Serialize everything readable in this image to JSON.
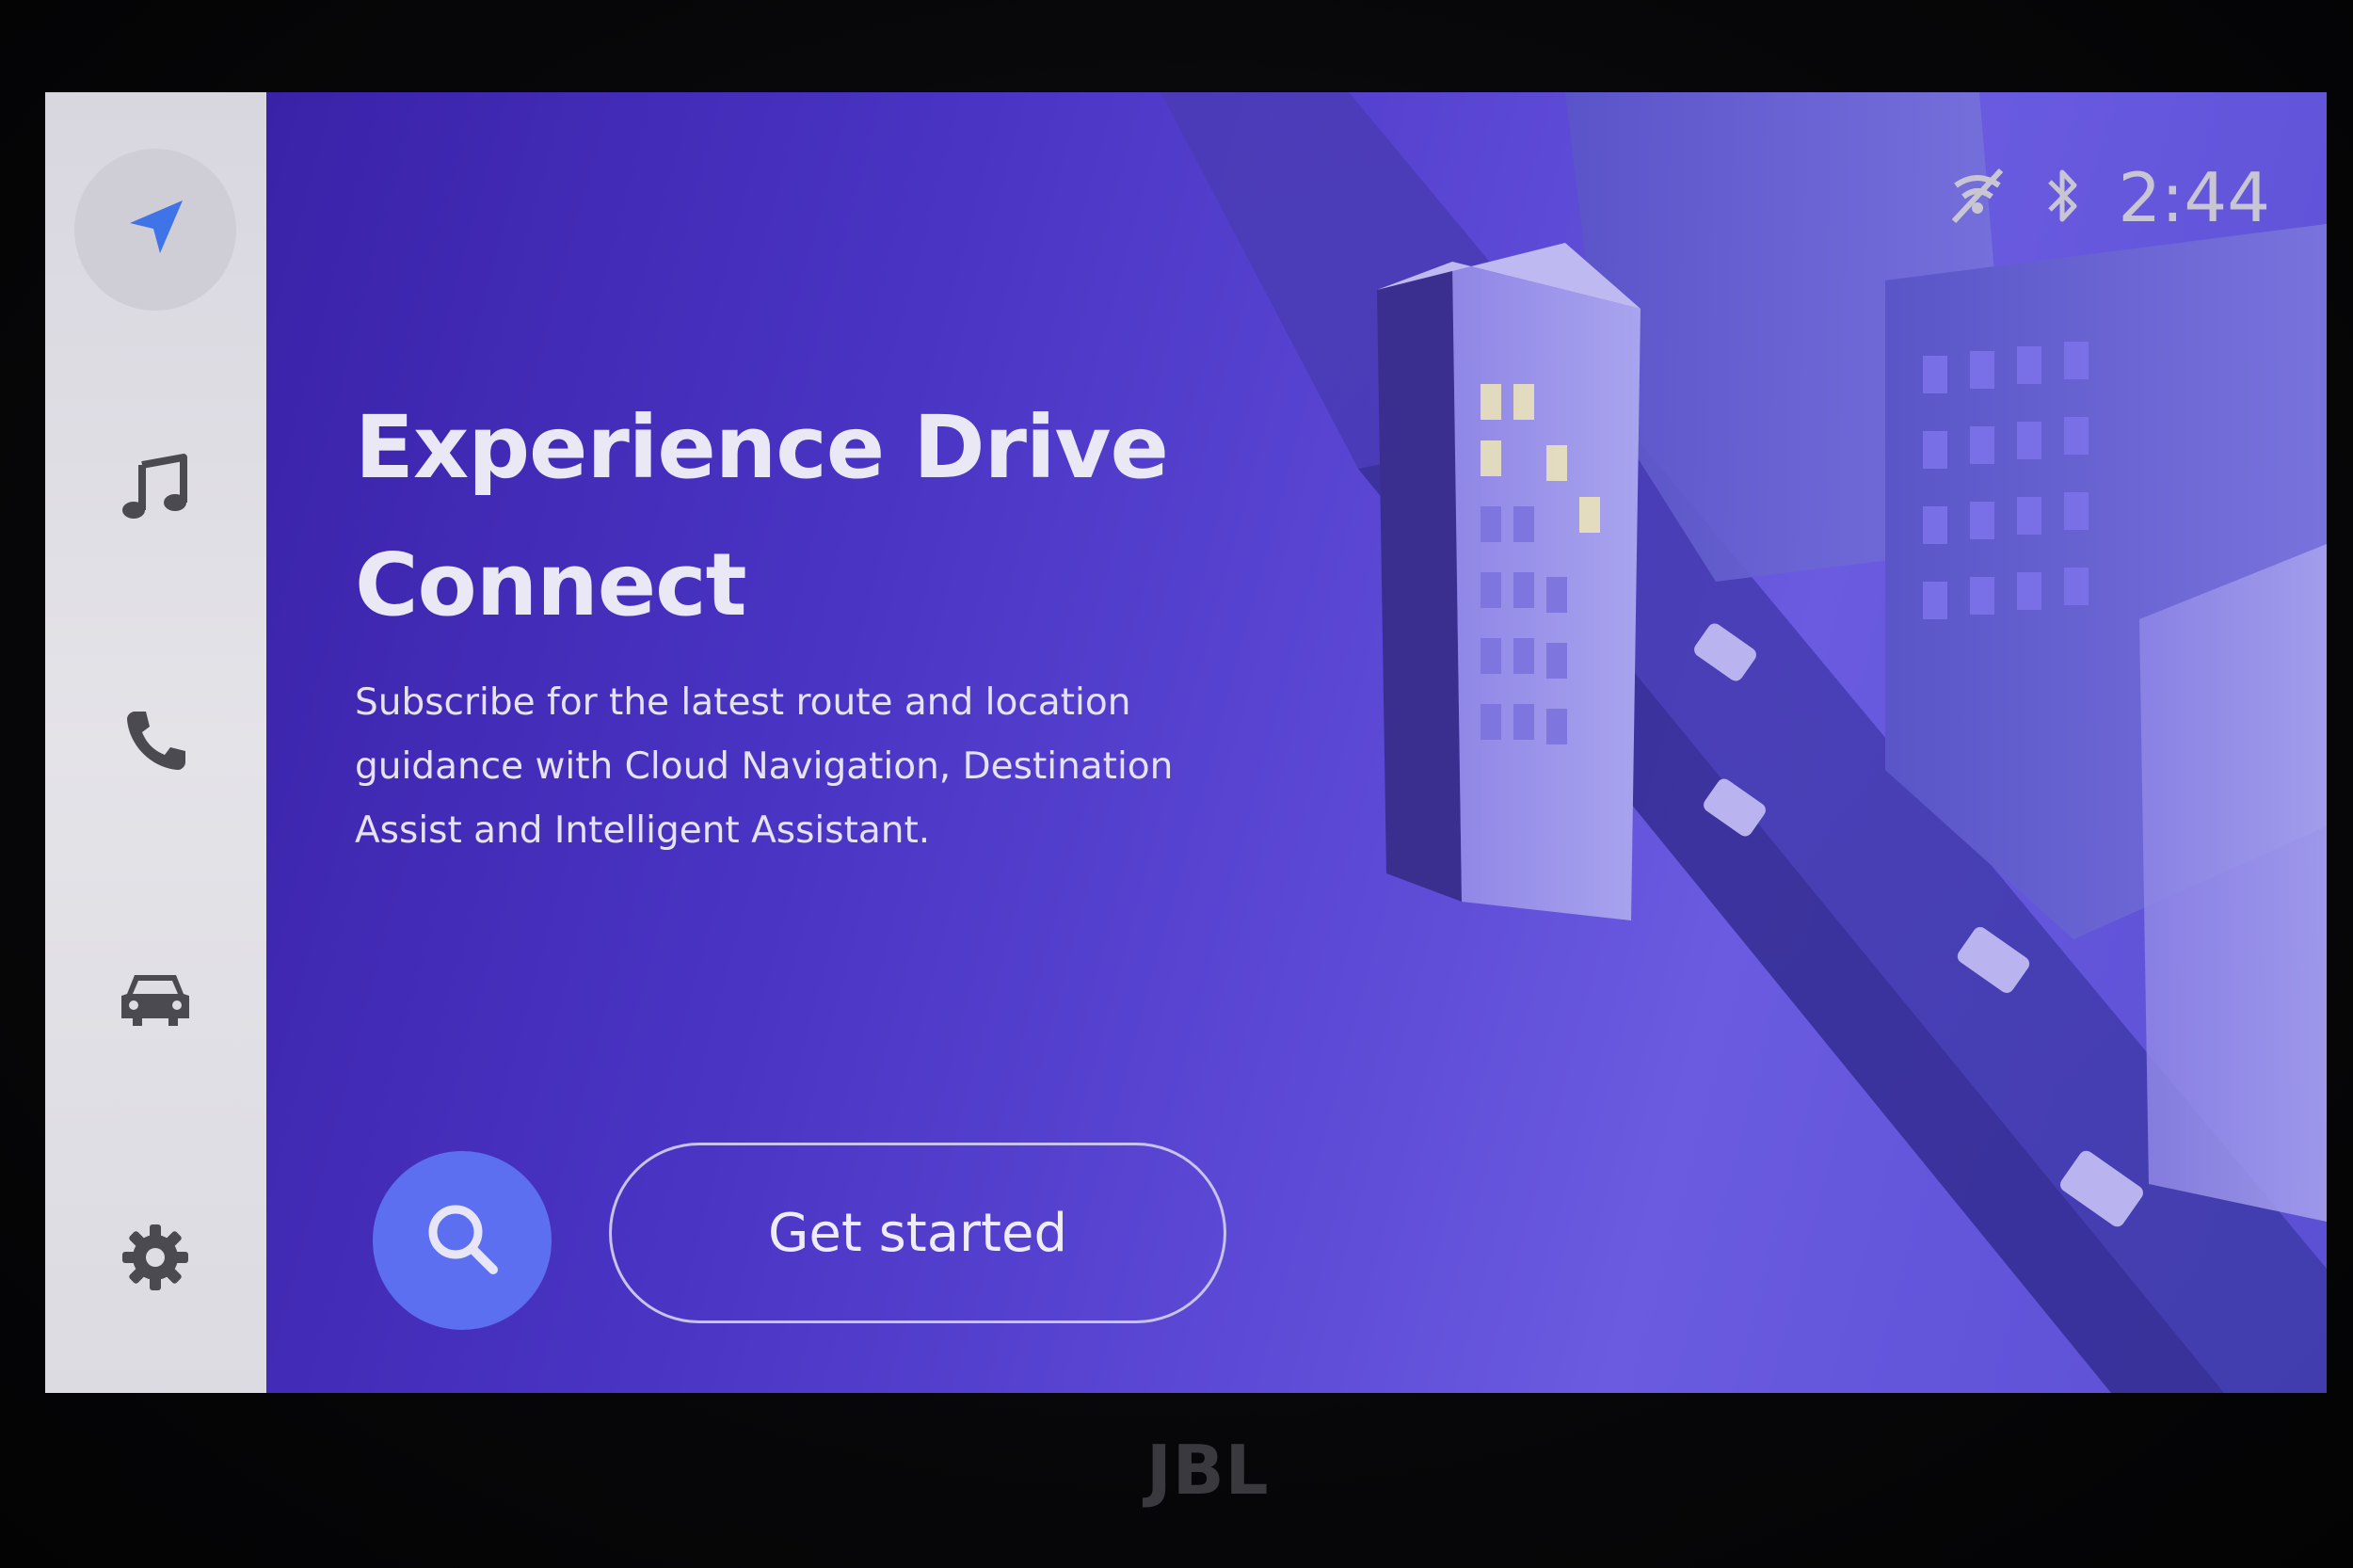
{
  "sidebar": {
    "items": [
      {
        "icon": "navigation-arrow-icon",
        "active": true
      },
      {
        "icon": "music-note-icon",
        "active": false
      },
      {
        "icon": "phone-icon",
        "active": false
      },
      {
        "icon": "car-icon",
        "active": false
      },
      {
        "icon": "gear-icon",
        "active": false
      }
    ]
  },
  "status_bar": {
    "icons": [
      "no-connection-icon",
      "bluetooth-icon"
    ],
    "time": "2:44"
  },
  "promo": {
    "title_line1": "Experience Drive",
    "title_line2": "Connect",
    "body_line1": "Subscribe for the latest route and location",
    "body_line2": "guidance with Cloud Navigation, Destination",
    "body_line3": "Assist and Intelligent Assistant."
  },
  "actions": {
    "search_icon": "search-icon",
    "get_started_label": "Get started"
  },
  "bezel": {
    "brand": "JBL"
  },
  "colors": {
    "sidebar_bg": "#dedde4",
    "accent_blue": "#3f74e8",
    "main_bg": "#4a34c4",
    "search_button": "#5c6ff0",
    "icon_gray": "#4a4a50"
  }
}
